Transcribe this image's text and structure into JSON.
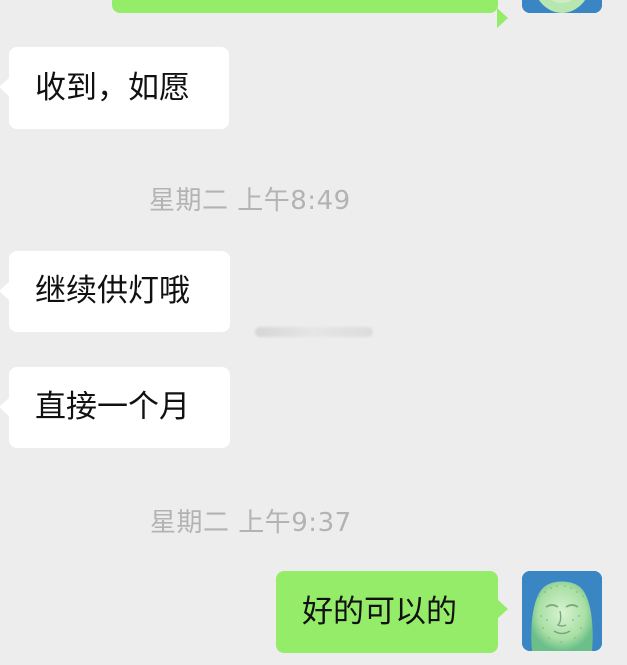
{
  "messages": [
    {
      "id": "m0",
      "direction": "out",
      "text": ""
    },
    {
      "id": "m1",
      "direction": "in",
      "text": "收到，如愿"
    },
    {
      "id": "m2",
      "direction": "in",
      "text": "继续供灯哦"
    },
    {
      "id": "m3",
      "direction": "in",
      "text": "直接一个月"
    },
    {
      "id": "m4",
      "direction": "out",
      "text": "好的可以的"
    }
  ],
  "timestamps": {
    "t1": "星期二 上午8:49",
    "t2": "星期二 上午9:37"
  },
  "colors": {
    "background": "#ededed",
    "incoming_bubble": "#ffffff",
    "outgoing_bubble": "#95ec69",
    "timestamp_text": "#b3b3b3"
  },
  "icons": {
    "avatar": "buddha-face-avatar-icon"
  }
}
